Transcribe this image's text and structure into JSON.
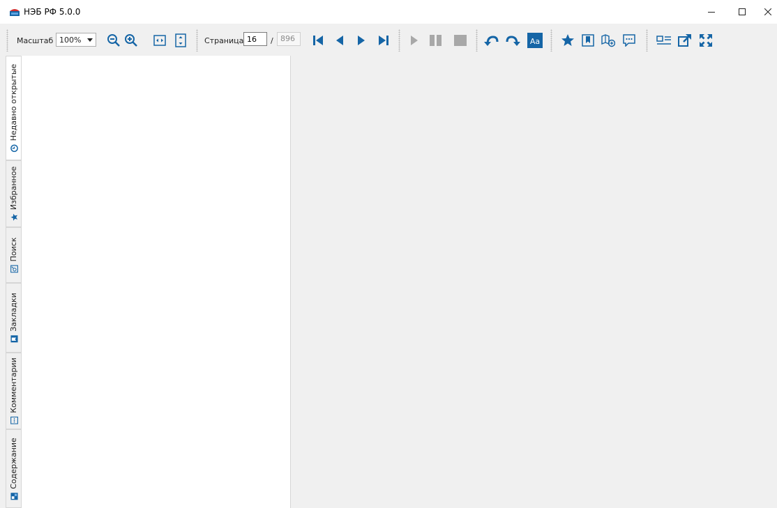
{
  "window": {
    "title": "НЭБ РФ 5.0.0",
    "logo_icon": "app-logo-icon",
    "controls": {
      "minimize_icon": "minimize-icon",
      "maximize_icon": "maximize-icon",
      "close_icon": "close-icon"
    }
  },
  "toolbar": {
    "zoom_label": "Масштаб",
    "zoom_value": "100%",
    "page_label": "Страница",
    "page_current": "16",
    "page_separator": "/",
    "page_total": "896",
    "icons": [
      "zoom-out-icon",
      "zoom-in-icon",
      "fit-width-icon",
      "fit-height-icon",
      "first-page-icon",
      "prev-page-icon",
      "next-page-icon",
      "last-page-icon",
      "play-icon",
      "pause-icon",
      "stop-icon",
      "rotate-left-icon",
      "rotate-right-icon",
      "text-mode-icon",
      "favorite-icon",
      "bookmark-icon",
      "add-map-icon",
      "comment-icon",
      "toc-icon",
      "open-external-icon",
      "fullscreen-icon"
    ]
  },
  "colors": {
    "accent": "#1565a6",
    "disabled": "#9e9e9e",
    "panel_bg": "#ffffff",
    "workspace_bg": "#f0f0f0"
  },
  "tabs": [
    {
      "label": "Недавно открытые",
      "icon": "clock-icon",
      "active": true
    },
    {
      "label": "Избранное",
      "icon": "star-icon",
      "active": false
    },
    {
      "label": "Поиск",
      "icon": "search-icon",
      "active": false
    },
    {
      "label": "Закладки",
      "icon": "bookmark-icon",
      "active": false
    },
    {
      "label": "Комментарии",
      "icon": "comment-icon",
      "active": false
    },
    {
      "label": "Содержание",
      "icon": "contents-icon",
      "active": false
    }
  ]
}
